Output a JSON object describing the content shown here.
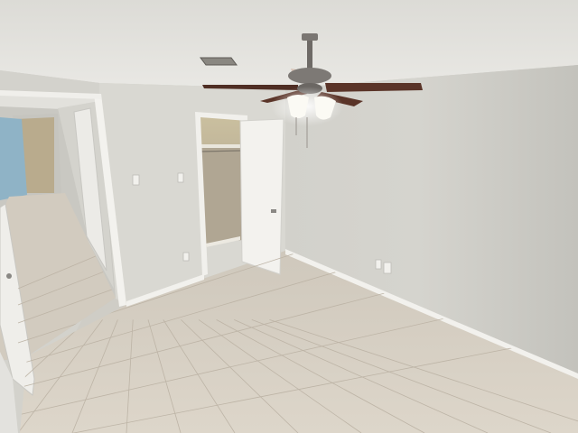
{
  "scene": {
    "description_free": true,
    "palette": {
      "ceiling": "#e6e5e1",
      "ceiling_shadow": "#d4d3ce",
      "right_wall": "#c9c8c2",
      "right_wall_light": "#d6d5cf",
      "left_wall": "#d8d7d1",
      "hall_wall": "#cfcec8",
      "floor": "#d7d0c4",
      "floor_dark": "#c9c1b4",
      "grout": "#bdb4a6",
      "baseboard": "#f1f0ec",
      "door": "#f3f2ee",
      "door_edge": "#d9d8d3",
      "closet_inside": "#b4aa98",
      "closet_shadow": "#8f8674",
      "fan_blade": "#5a3428",
      "fan_metal": "#6e6a66",
      "light_glass": "#f8f6ee",
      "vent": "#6f6c66",
      "bathroom_blue": "#8fb3c6",
      "bathroom_wall": "#b9ab8d"
    }
  }
}
